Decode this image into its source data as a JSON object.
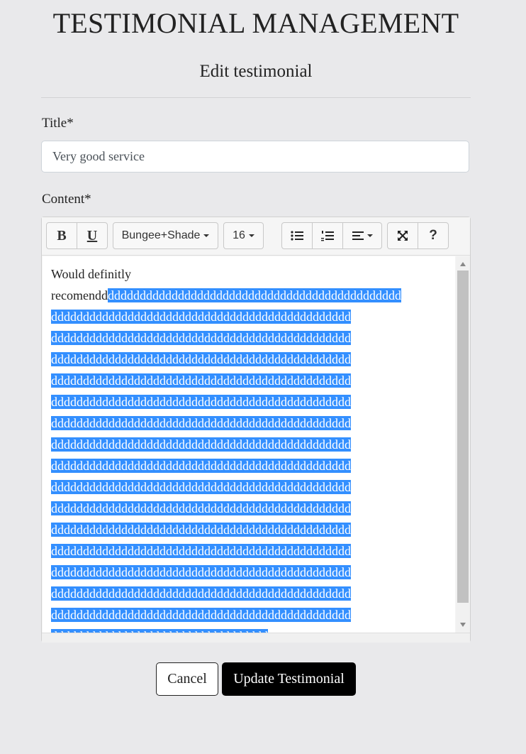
{
  "header": {
    "title": "TESTIMONIAL MANAGEMENT",
    "subtitle": "Edit testimonial"
  },
  "form": {
    "title_label": "Title*",
    "title_value": "Very good service",
    "content_label": "Content*"
  },
  "toolbar": {
    "bold_label": "B",
    "underline_label": "U",
    "font_name": "Bungee+Shade",
    "font_size": "16",
    "help_label": "?",
    "icons": [
      "bold-icon",
      "underline-icon",
      "unordered-list-icon",
      "ordered-list-icon",
      "align-icon",
      "fullscreen-icon",
      "help-icon"
    ]
  },
  "editor": {
    "line1": "Would definitly",
    "line2_plain": "recomendd",
    "line2_selected": "dddddddddddddddddddddddddddddddddddddddddddddd",
    "selected_lines": [
      "ddddddddddddddddddddddddddddddddddddddddddddddd",
      "ddddddddddddddddddddddddddddddddddddddddddddddd",
      "ddddddddddddddddddddddddddddddddddddddddddddddd",
      "ddddddddddddddddddddddddddddddddddddddddddddddd",
      "ddddddddddddddddddddddddddddddddddddddddddddddd",
      "ddddddddddddddddddddddddddddddddddddddddddddddd",
      "ddddddddddddddddddddddddddddddddddddddddddddddd",
      "ddddddddddddddddddddddddddddddddddddddddddddddd",
      "ddddddddddddddddddddddddddddddddddddddddddddddd",
      "ddddddddddddddddddddddddddddddddddddddddddddddd",
      "ddddddddddddddddddddddddddddddddddddddddddddddd",
      "ddddddddddddddddddddddddddddddddddddddddddddddd",
      "ddddddddddddddddddddddddddddddddddddddddddddddd",
      "ddddddddddddddddddddddddddddddddddddddddddddddd",
      "ddddddddddddddddddddddddddddddddddddddddddddddd",
      "dddddddddddddddddddddddddddddddddd"
    ],
    "selection_color": "#338fff"
  },
  "actions": {
    "cancel_label": "Cancel",
    "update_label": "Update Testimonial"
  }
}
